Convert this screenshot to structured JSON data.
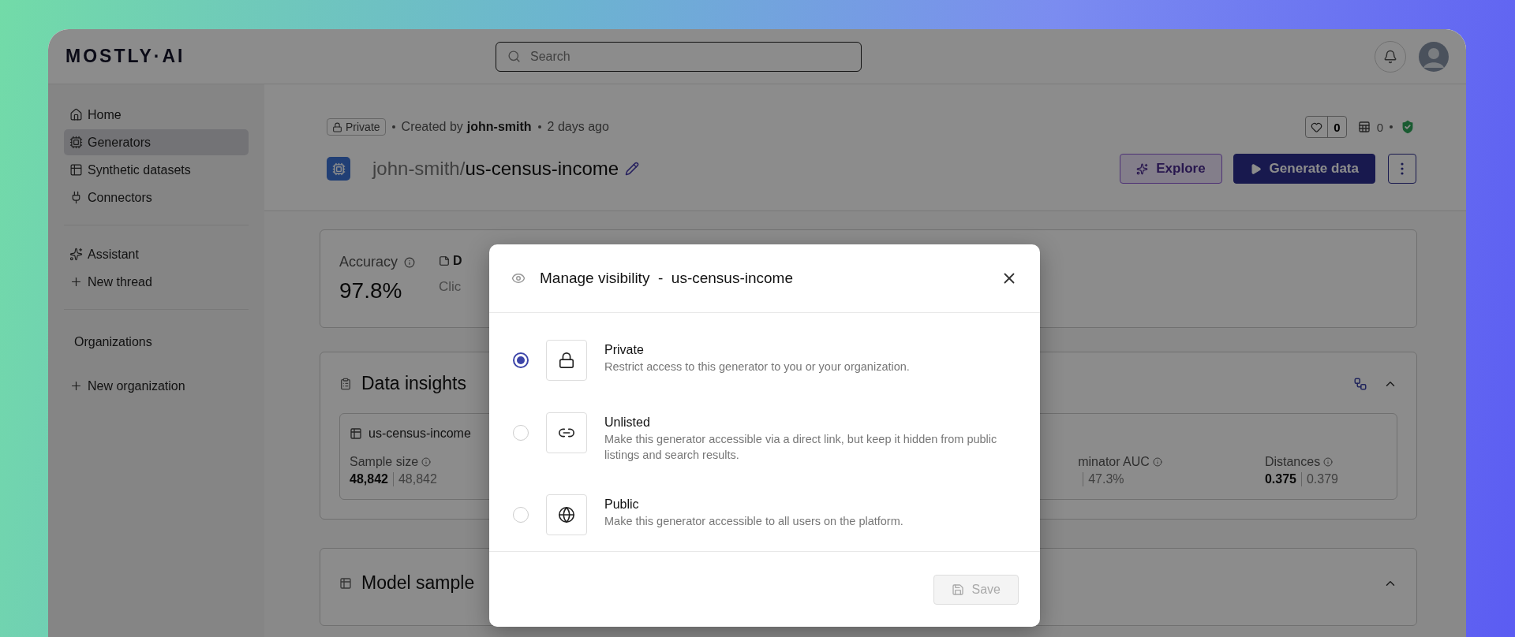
{
  "topbar": {
    "logo": "MOSTLY·AI",
    "search": {
      "placeholder": "Search"
    }
  },
  "sidebar": {
    "items": [
      {
        "label": "Home",
        "selected": false
      },
      {
        "label": "Generators",
        "selected": true
      },
      {
        "label": "Synthetic datasets",
        "selected": false
      },
      {
        "label": "Connectors",
        "selected": false
      }
    ],
    "assistant": [
      {
        "label": "Assistant"
      },
      {
        "label": "New thread"
      }
    ],
    "organizations": {
      "heading": "Organizations",
      "items": [
        {
          "label": "New organization"
        }
      ]
    }
  },
  "generator": {
    "badge": "Private",
    "created_prefix": "Created by",
    "author": "john-smith",
    "age": "2 days ago",
    "owner": "john-smith/",
    "name": "us-census-income",
    "likes": "0",
    "datasets": "0",
    "buttons": [
      {
        "label": "Explore",
        "kind": "secondary"
      },
      {
        "label": "Generate data",
        "kind": "primary"
      }
    ]
  },
  "accuracy": {
    "label": "Accuracy",
    "value": "97.8%",
    "notes_label": "D",
    "notes_hint": "Clic"
  },
  "data_insights": {
    "title": "Data insights",
    "table": "us-census-income",
    "metrics": [
      {
        "label": "Sample size",
        "value": "48,842",
        "reference": "48,842"
      },
      {
        "label": "minator AUC",
        "reference": "47.3%"
      },
      {
        "label": "Distances",
        "value": "0.375",
        "reference": "0.379"
      }
    ]
  },
  "model_samples": {
    "title": "Model sample"
  },
  "modal": {
    "title": "Manage visibility  -  us-census-income",
    "options": [
      {
        "title": "Private",
        "description": "Restrict access to this generator to you or your organization.",
        "selected": true
      },
      {
        "title": "Unlisted",
        "description": "Make this generator accessible via a direct link, but keep it hidden from public listings and search results.",
        "selected": false
      },
      {
        "title": "Public",
        "description": "Make this generator accessible to all users on the platform.",
        "selected": false
      }
    ],
    "save": {
      "label": "Save",
      "disabled": true
    }
  }
}
